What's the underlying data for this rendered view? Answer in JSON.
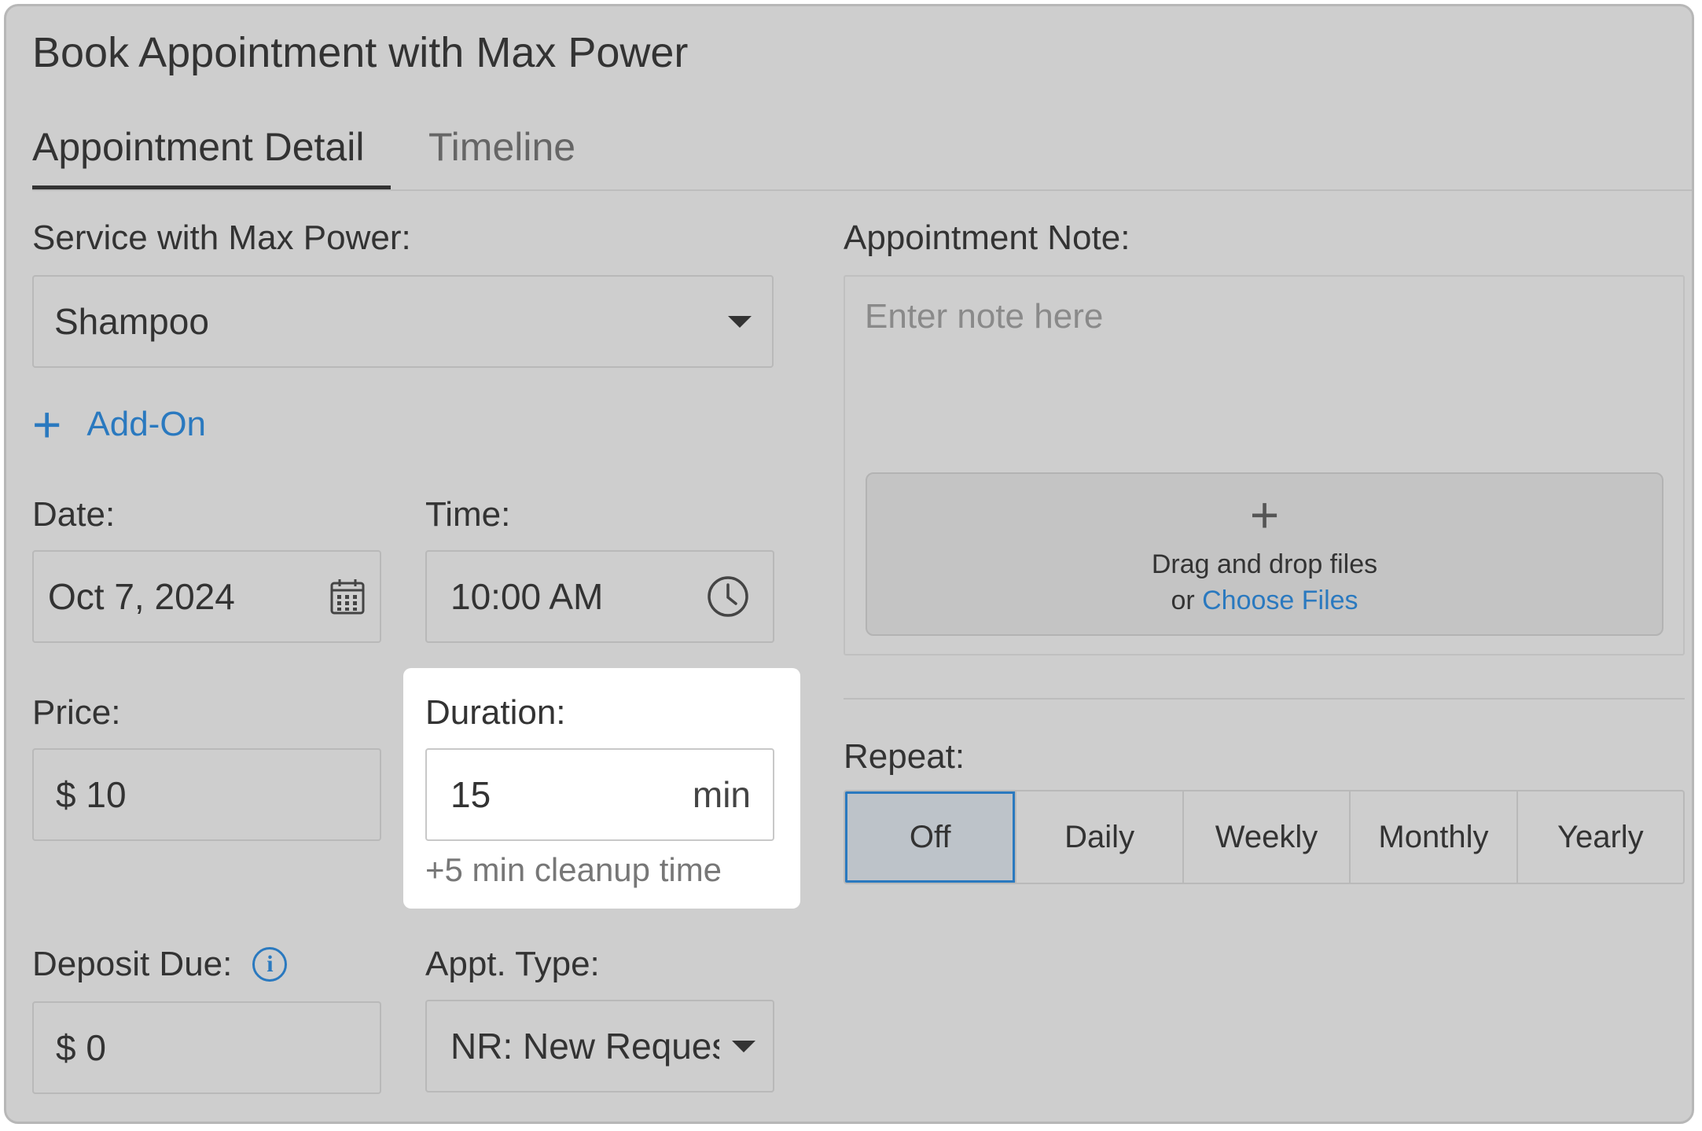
{
  "dialog": {
    "title": "Book Appointment with Max Power"
  },
  "tabs": [
    {
      "label": "Appointment Detail",
      "active": true
    },
    {
      "label": "Timeline",
      "active": false
    }
  ],
  "service": {
    "label": "Service with Max Power:",
    "value": "Shampoo"
  },
  "addon": {
    "label": "Add-On"
  },
  "date": {
    "label": "Date:",
    "value": "Oct 7, 2024"
  },
  "time": {
    "label": "Time:",
    "value": "10:00 AM"
  },
  "price": {
    "label": "Price:",
    "value": "$ 10"
  },
  "duration": {
    "label": "Duration:",
    "value": "15",
    "unit": "min",
    "cleanup_hint": "+5 min cleanup time"
  },
  "deposit": {
    "label": "Deposit Due:",
    "value": "$ 0"
  },
  "appt_type": {
    "label": "Appt. Type:",
    "value": "NR: New Request"
  },
  "note": {
    "label": "Appointment Note:",
    "placeholder": "Enter note here",
    "dropzone_line1": "Drag and drop files",
    "dropzone_or": "or",
    "dropzone_link": "Choose Files"
  },
  "repeat": {
    "label": "Repeat:",
    "options": [
      "Off",
      "Daily",
      "Weekly",
      "Monthly",
      "Yearly"
    ],
    "selected": "Off"
  },
  "colors": {
    "accent": "#2a79bf",
    "background": "#cecece",
    "text": "#333333"
  }
}
